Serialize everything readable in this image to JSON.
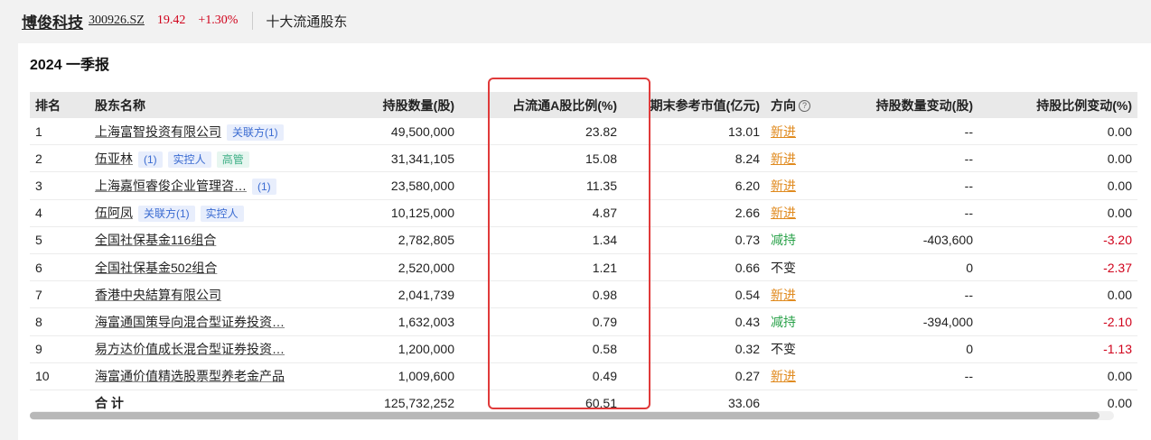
{
  "header": {
    "stock_name": "博俊科技",
    "stock_code": "300926.SZ",
    "price": "19.42",
    "change": "+1.30%",
    "section": "十大流通股东"
  },
  "period": "2024 一季报",
  "columns": {
    "rank": "排名",
    "name": "股东名称",
    "shares": "持股数量(股)",
    "ratio": "占流通A股比例(%)",
    "market_value": "期末参考市值(亿元)",
    "direction": "方向",
    "share_change": "持股数量变动(股)",
    "ratio_change": "持股比例变动(%)"
  },
  "rows": [
    {
      "rank": "1",
      "name": "上海富智投资有限公司",
      "tags": [
        {
          "text": "关联方(1)",
          "style": "blue"
        }
      ],
      "shares": "49,500,000",
      "ratio": "23.82",
      "mv": "13.01",
      "dir": "新进",
      "dir_type": "new",
      "share_change": "--",
      "ratio_change": "0.00",
      "rc_neg": false
    },
    {
      "rank": "2",
      "name": "伍亚林",
      "tags": [
        {
          "text": "(1)",
          "style": "blue"
        },
        {
          "text": "实控人",
          "style": "blue"
        },
        {
          "text": "高管",
          "style": "green"
        }
      ],
      "shares": "31,341,105",
      "ratio": "15.08",
      "mv": "8.24",
      "dir": "新进",
      "dir_type": "new",
      "share_change": "--",
      "ratio_change": "0.00",
      "rc_neg": false
    },
    {
      "rank": "3",
      "name": "上海嘉恒睿俊企业管理咨…",
      "tags": [
        {
          "text": "(1)",
          "style": "blue"
        }
      ],
      "shares": "23,580,000",
      "ratio": "11.35",
      "mv": "6.20",
      "dir": "新进",
      "dir_type": "new",
      "share_change": "--",
      "ratio_change": "0.00",
      "rc_neg": false
    },
    {
      "rank": "4",
      "name": "伍阿凤",
      "tags": [
        {
          "text": "关联方(1)",
          "style": "blue"
        },
        {
          "text": "实控人",
          "style": "blue"
        }
      ],
      "shares": "10,125,000",
      "ratio": "4.87",
      "mv": "2.66",
      "dir": "新进",
      "dir_type": "new",
      "share_change": "--",
      "ratio_change": "0.00",
      "rc_neg": false
    },
    {
      "rank": "5",
      "name": "全国社保基金116组合",
      "tags": [],
      "shares": "2,782,805",
      "ratio": "1.34",
      "mv": "0.73",
      "dir": "减持",
      "dir_type": "down",
      "share_change": "-403,600",
      "ratio_change": "-3.20",
      "rc_neg": true
    },
    {
      "rank": "6",
      "name": "全国社保基金502组合",
      "tags": [],
      "shares": "2,520,000",
      "ratio": "1.21",
      "mv": "0.66",
      "dir": "不变",
      "dir_type": "same",
      "share_change": "0",
      "ratio_change": "-2.37",
      "rc_neg": true
    },
    {
      "rank": "7",
      "name": "香港中央結算有限公司",
      "tags": [],
      "shares": "2,041,739",
      "ratio": "0.98",
      "mv": "0.54",
      "dir": "新进",
      "dir_type": "new",
      "share_change": "--",
      "ratio_change": "0.00",
      "rc_neg": false
    },
    {
      "rank": "8",
      "name": "海富通国策导向混合型证券投资…",
      "tags": [],
      "shares": "1,632,003",
      "ratio": "0.79",
      "mv": "0.43",
      "dir": "减持",
      "dir_type": "down",
      "share_change": "-394,000",
      "ratio_change": "-2.10",
      "rc_neg": true
    },
    {
      "rank": "9",
      "name": "易方达价值成长混合型证券投资…",
      "tags": [],
      "shares": "1,200,000",
      "ratio": "0.58",
      "mv": "0.32",
      "dir": "不变",
      "dir_type": "same",
      "share_change": "0",
      "ratio_change": "-1.13",
      "rc_neg": true
    },
    {
      "rank": "10",
      "name": "海富通价值精选股票型养老金产品",
      "tags": [],
      "shares": "1,009,600",
      "ratio": "0.49",
      "mv": "0.27",
      "dir": "新进",
      "dir_type": "new",
      "share_change": "--",
      "ratio_change": "0.00",
      "rc_neg": false
    }
  ],
  "total": {
    "label": "合 计",
    "shares": "125,732,252",
    "ratio": "60.51",
    "mv": "33.06",
    "ratio_change": "0.00"
  },
  "icons": {
    "help": "question-circle-icon"
  },
  "colors": {
    "up": "#d0021b",
    "down": "#2aa24a",
    "new": "#e08a1e",
    "highlight": "#e03a3a",
    "tag_blue": "#3a6bd1",
    "tag_green": "#3cae84"
  }
}
